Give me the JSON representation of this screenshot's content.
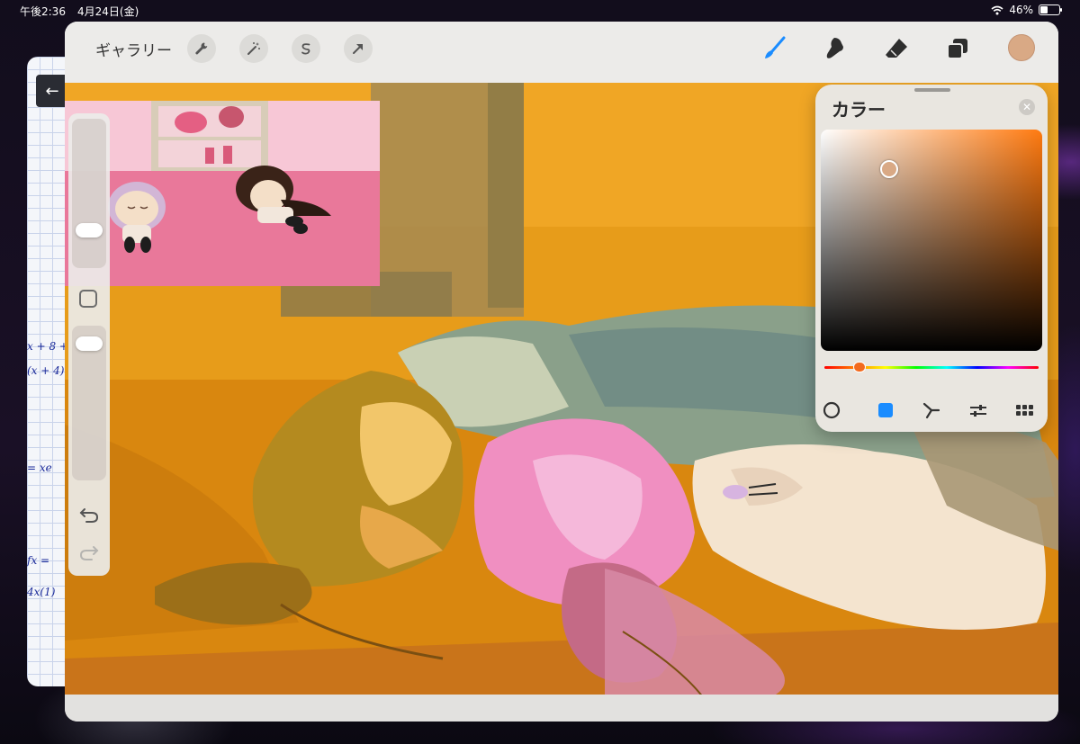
{
  "status_bar": {
    "time": "午後2:36",
    "date": "4月24日(金)",
    "battery_percent": "46%",
    "battery_level": 0.46
  },
  "notes": {
    "math_lines": [
      "x + 8 +",
      "(x + 4)",
      "= xe",
      "fx =",
      "4x(1)"
    ]
  },
  "toolbar": {
    "gallery_label": "ギャラリー",
    "left_tools": [
      "wrench-icon",
      "magic-wand-icon",
      "selection-icon",
      "move-arrow-icon"
    ],
    "right_tools": [
      "brush-icon",
      "smudge-icon",
      "eraser-icon",
      "layers-icon"
    ],
    "active_tool": "brush-icon",
    "current_color": "#d9a985"
  },
  "color_panel": {
    "title": "カラー",
    "current_color": "#d9a985",
    "hue_color": "#ff7a10",
    "modes": [
      "disc-icon",
      "classic-icon",
      "harmony-icon",
      "value-icon",
      "palettes-icon"
    ],
    "active_mode": "classic-icon"
  },
  "accent": "#1a8cff"
}
